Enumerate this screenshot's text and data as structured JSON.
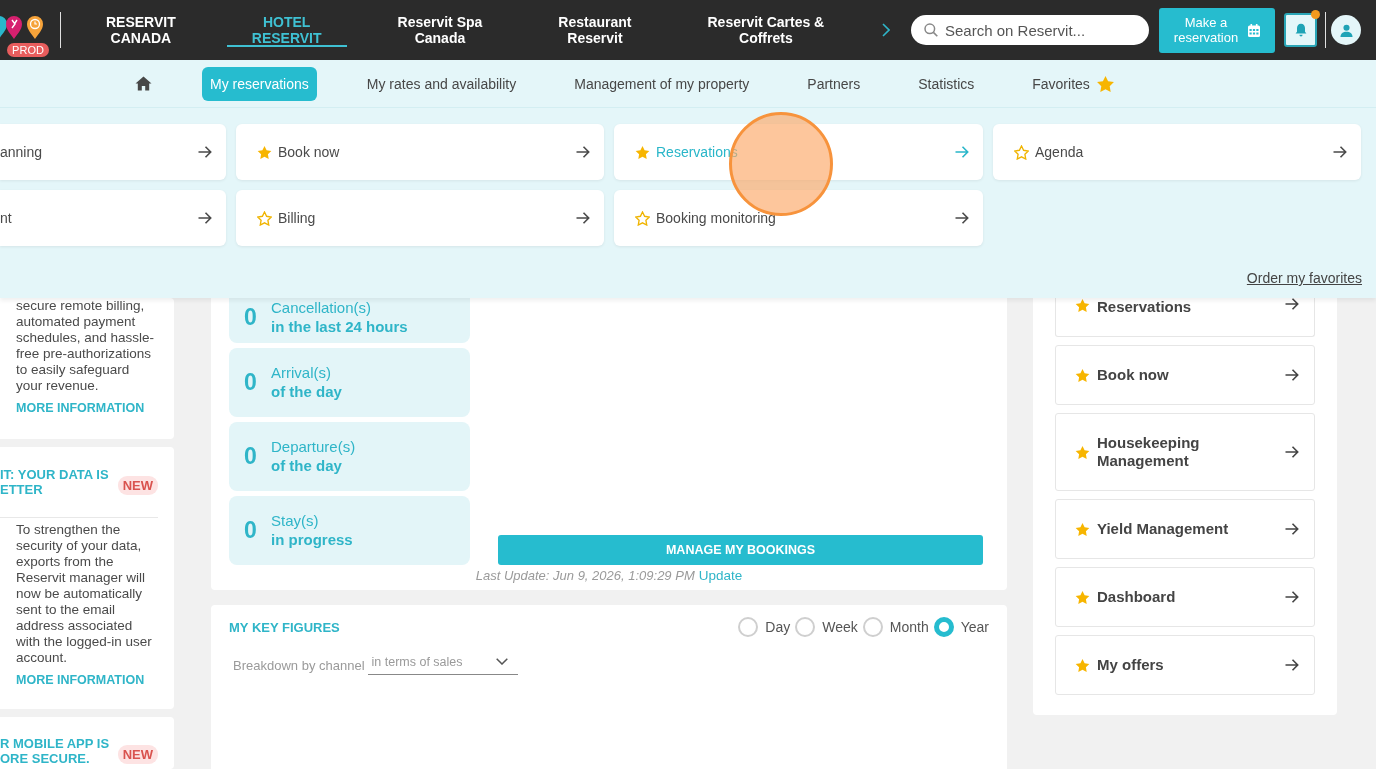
{
  "top_bar": {
    "badge": "PROD",
    "nav": [
      {
        "label": "RESERVIT\nCANADA",
        "selected": false
      },
      {
        "label": "HOTEL\nRESERVIT",
        "selected": true
      },
      {
        "label": "Reservit Spa\nCanada",
        "selected": false
      },
      {
        "label": "Restaurant\nReservit",
        "selected": false
      },
      {
        "label": "Reservit Cartes &\nCoffrets",
        "selected": false
      }
    ],
    "search": {
      "placeholder": "Search on Reservit..."
    },
    "make_reservation": "Make a\nreservation",
    "notifications": {
      "unread": true
    }
  },
  "sub_nav": {
    "items": [
      {
        "kind": "home",
        "selected": false
      },
      {
        "kind": "text",
        "label": "My reservations",
        "selected": true
      },
      {
        "kind": "text",
        "label": "My rates and availability",
        "selected": false
      },
      {
        "kind": "text",
        "label": "Management of my property",
        "selected": false
      },
      {
        "kind": "text",
        "label": "Partners",
        "selected": false
      },
      {
        "kind": "text",
        "label": "Statistics",
        "selected": false
      },
      {
        "kind": "favorites",
        "label": "Favorites",
        "selected": false
      }
    ]
  },
  "menu_panel": {
    "cards": [
      {
        "kind": "cut",
        "label": "anning",
        "selected": false
      },
      {
        "kind": "link",
        "label": "Book now",
        "favorite": true,
        "selected": false
      },
      {
        "kind": "link",
        "label": "Reservations",
        "favorite": true,
        "selected": true
      },
      {
        "kind": "link",
        "label": "Agenda",
        "favorite": false,
        "selected": false
      },
      {
        "kind": "cut",
        "label": "nt",
        "selected": false
      },
      {
        "kind": "link",
        "label": "Billing",
        "favorite": false,
        "selected": false
      },
      {
        "kind": "link",
        "label": "Booking monitoring",
        "favorite": false,
        "selected": false
      }
    ],
    "order_link": "Order my favorites"
  },
  "news": [
    {
      "text": "secure remote billing, automated payment schedules, and hassle-free pre-authorizations to easily safeguard your revenue.",
      "link": "MORE INFORMATION"
    },
    {
      "title": "IT: YOUR DATA IS\nETTER",
      "badge": "NEW",
      "text": "To strengthen the security of your data, exports from the Reservit manager will now be automatically sent to the email address associated with the logged-in user account.",
      "link": "MORE INFORMATION"
    },
    {
      "title": "R MOBILE APP IS\nORE SECURE.",
      "badge": "NEW"
    }
  ],
  "activity": {
    "stats": [
      {
        "value": "0",
        "label": "Cancellation(s)",
        "period": "in the last 24 hours"
      },
      {
        "value": "0",
        "label": "Arrival(s)",
        "period": "of the day"
      },
      {
        "value": "0",
        "label": "Departure(s)",
        "period": "of the day"
      },
      {
        "value": "0",
        "label": "Stay(s)",
        "period": "in progress"
      }
    ],
    "button": "MANAGE MY BOOKINGS",
    "last_update": "Last Update: Jun 9, 2026, 1:09:29 PM",
    "update_link": "Update"
  },
  "key_figures": {
    "title": "MY KEY FIGURES",
    "periods": [
      {
        "label": "Day",
        "selected": false
      },
      {
        "label": "Week",
        "selected": false
      },
      {
        "label": "Month",
        "selected": false
      },
      {
        "label": "Year",
        "selected": true
      }
    ],
    "breakdown_label": "Breakdown by channel",
    "breakdown_value": "in terms of sales"
  },
  "favorites": [
    {
      "label": "Reservations",
      "favorite": true
    },
    {
      "label": "Book now",
      "favorite": true
    },
    {
      "label": "Housekeeping Management",
      "favorite": true
    },
    {
      "label": "Yield Management",
      "favorite": true
    },
    {
      "label": "Dashboard",
      "favorite": true
    },
    {
      "label": "My offers",
      "favorite": true
    }
  ]
}
